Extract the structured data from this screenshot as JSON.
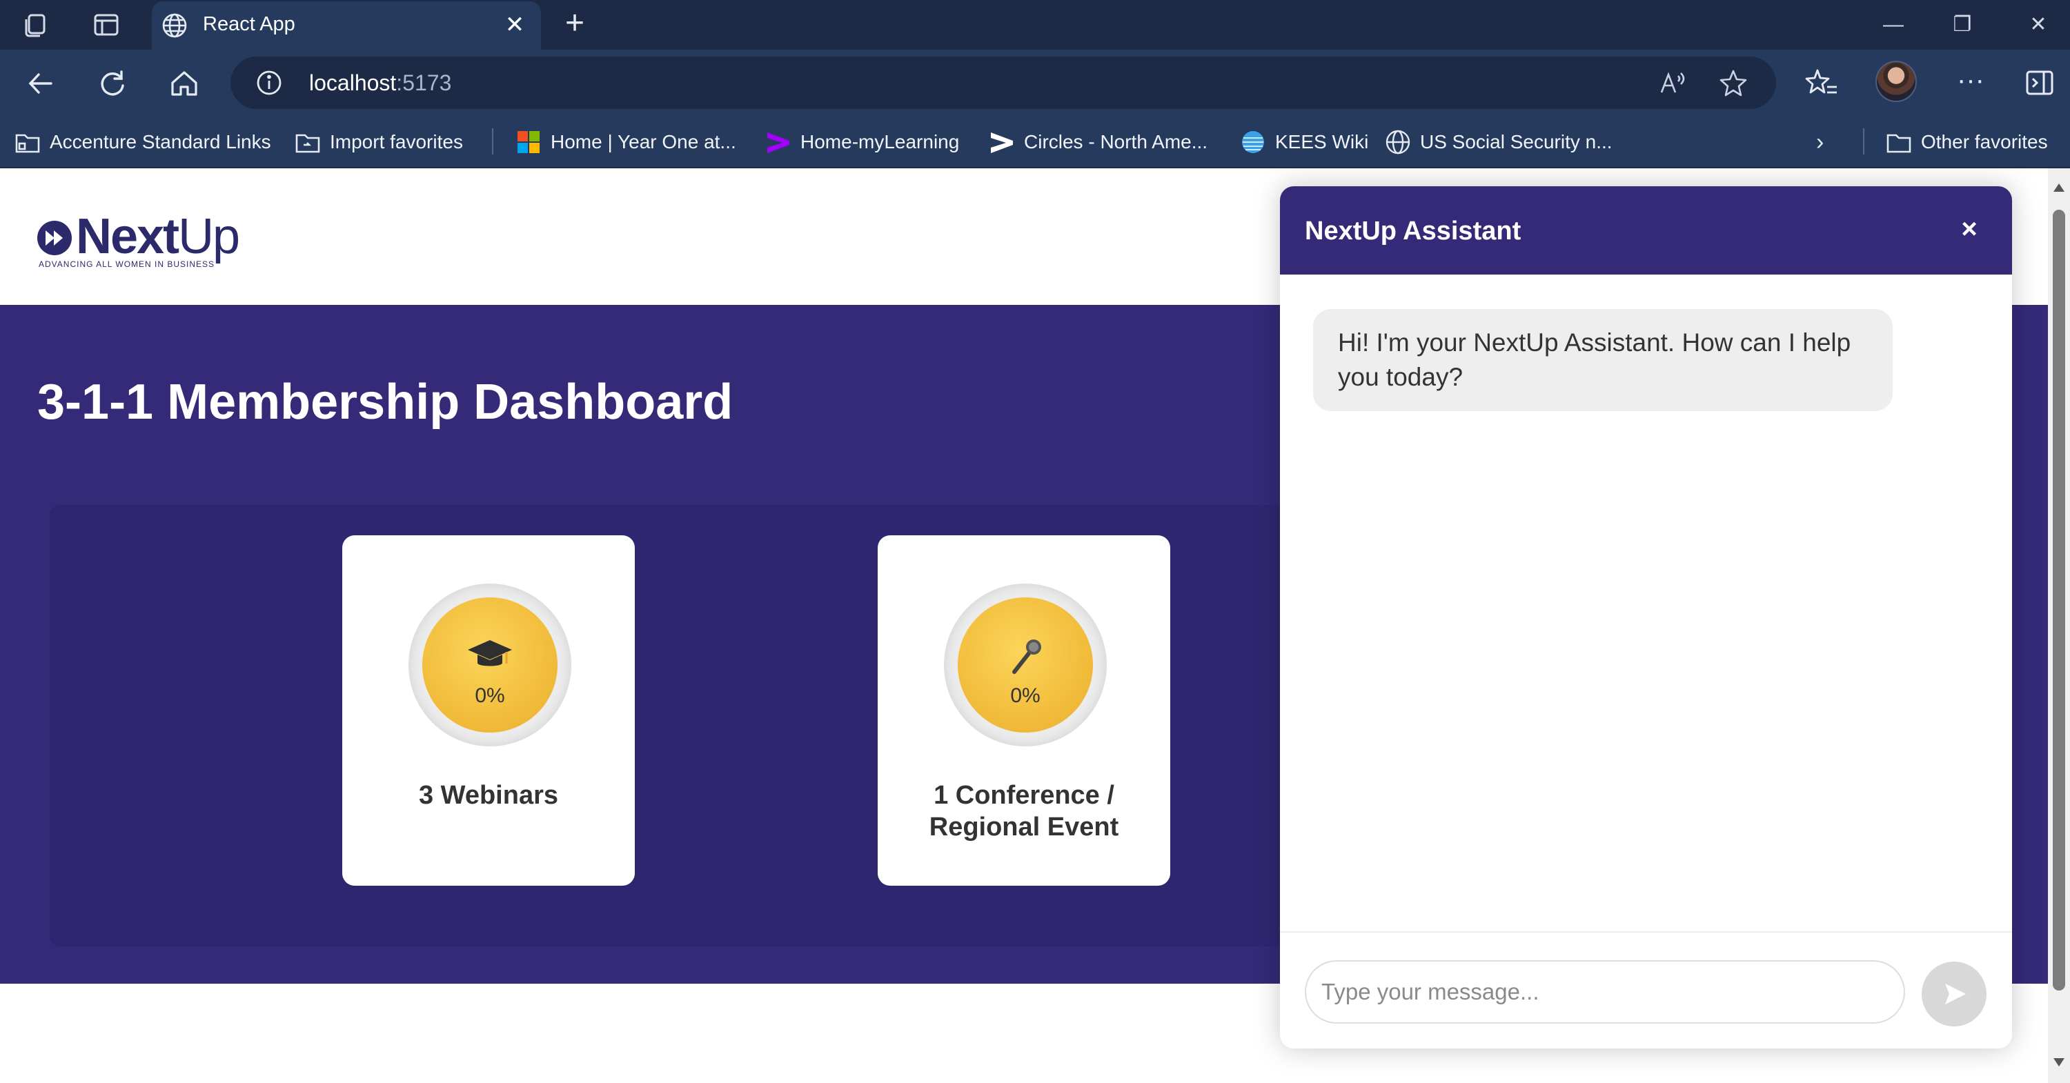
{
  "browser": {
    "tab_title": "React App",
    "url_host": "localhost",
    "url_port": ":5173",
    "bookmarks": [
      {
        "label": "Accenture Standard Links",
        "icon": "folder-icon"
      },
      {
        "label": "Import favorites",
        "icon": "import-icon"
      },
      {
        "label": "Home | Year One at...",
        "icon": "microsoft-logo-icon"
      },
      {
        "label": "Home-myLearning",
        "icon": "accenture-logo-icon"
      },
      {
        "label": "Circles - North Ame...",
        "icon": "chevron-logo-icon"
      },
      {
        "label": "KEES Wiki",
        "icon": "att-globe-icon"
      },
      {
        "label": "US Social Security n...",
        "icon": "globe-icon"
      }
    ],
    "other_favorites": "Other favorites"
  },
  "logo": {
    "word_main": "Next",
    "word_end": "Up",
    "tagline": "ADVANCING ALL WOMEN IN BUSINESS"
  },
  "dashboard": {
    "title": "3-1-1 Membership Dashboard",
    "cards": [
      {
        "icon": "graduation-cap-icon",
        "progress": "0%",
        "label": "3 Webinars"
      },
      {
        "icon": "microphone-icon",
        "progress": "0%",
        "label": "1 Conference / Regional Event"
      }
    ]
  },
  "chat": {
    "title": "NextUp Assistant",
    "close_glyph": "×",
    "messages": [
      {
        "from": "assistant",
        "text": "Hi! I'm your NextUp Assistant. How can I help you today?"
      }
    ],
    "input_placeholder": "Type your message...",
    "send_glyph": "send-icon"
  },
  "colors": {
    "brand_purple": "#342a78",
    "chrome_dark": "#1c2a45",
    "chrome": "#263a5e",
    "progress_gold": "#f2bd3c"
  }
}
